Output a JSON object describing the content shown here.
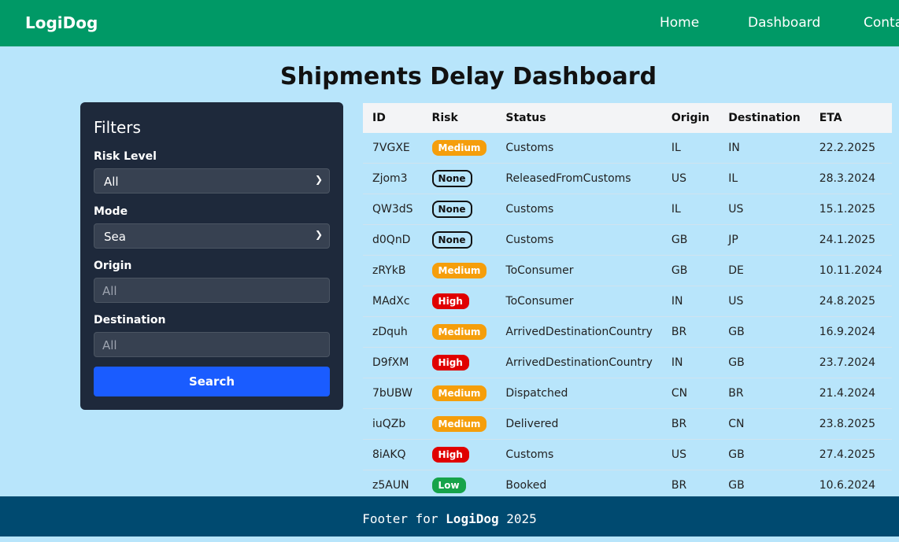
{
  "nav": {
    "brand": "LogiDog",
    "links": [
      "Home",
      "Dashboard",
      "Contact"
    ]
  },
  "page_title": "Shipments Delay Dashboard",
  "filters": {
    "heading": "Filters",
    "risk_label": "Risk Level",
    "risk_value": "All",
    "mode_label": "Mode",
    "mode_value": "Sea",
    "origin_label": "Origin",
    "origin_placeholder": "All",
    "destination_label": "Destination",
    "destination_placeholder": "All",
    "search_label": "Search"
  },
  "table": {
    "headers": [
      "ID",
      "Risk",
      "Status",
      "Origin",
      "Destination",
      "ETA"
    ],
    "rows": [
      {
        "id": "7VGXE",
        "risk": "Medium",
        "status": "Customs",
        "origin": "IL",
        "destination": "IN",
        "eta": "22.2.2025"
      },
      {
        "id": "Zjom3",
        "risk": "None",
        "status": "ReleasedFromCustoms",
        "origin": "US",
        "destination": "IL",
        "eta": "28.3.2024"
      },
      {
        "id": "QW3dS",
        "risk": "None",
        "status": "Customs",
        "origin": "IL",
        "destination": "US",
        "eta": "15.1.2025"
      },
      {
        "id": "d0QnD",
        "risk": "None",
        "status": "Customs",
        "origin": "GB",
        "destination": "JP",
        "eta": "24.1.2025"
      },
      {
        "id": "zRYkB",
        "risk": "Medium",
        "status": "ToConsumer",
        "origin": "GB",
        "destination": "DE",
        "eta": "10.11.2024"
      },
      {
        "id": "MAdXc",
        "risk": "High",
        "status": "ToConsumer",
        "origin": "IN",
        "destination": "US",
        "eta": "24.8.2025"
      },
      {
        "id": "zDquh",
        "risk": "Medium",
        "status": "ArrivedDestinationCountry",
        "origin": "BR",
        "destination": "GB",
        "eta": "16.9.2024"
      },
      {
        "id": "D9fXM",
        "risk": "High",
        "status": "ArrivedDestinationCountry",
        "origin": "IN",
        "destination": "GB",
        "eta": "23.7.2024"
      },
      {
        "id": "7bUBW",
        "risk": "Medium",
        "status": "Dispatched",
        "origin": "CN",
        "destination": "BR",
        "eta": "21.4.2024"
      },
      {
        "id": "iuQZb",
        "risk": "Medium",
        "status": "Delivered",
        "origin": "BR",
        "destination": "CN",
        "eta": "23.8.2025"
      },
      {
        "id": "8iAKQ",
        "risk": "High",
        "status": "Customs",
        "origin": "US",
        "destination": "GB",
        "eta": "27.4.2025"
      },
      {
        "id": "z5AUN",
        "risk": "Low",
        "status": "Booked",
        "origin": "BR",
        "destination": "GB",
        "eta": "10.6.2024"
      }
    ]
  },
  "footer": {
    "prefix": "Footer for ",
    "brand": "LogiDog",
    "year": " 2025"
  },
  "colors": {
    "nav": "#009966",
    "background": "#b8e5fb",
    "panel": "#1e293b",
    "button": "#1a5cff",
    "footer": "#004a70",
    "risk_medium": "#f59e0b",
    "risk_high": "#e00000",
    "risk_low": "#16a34a"
  }
}
